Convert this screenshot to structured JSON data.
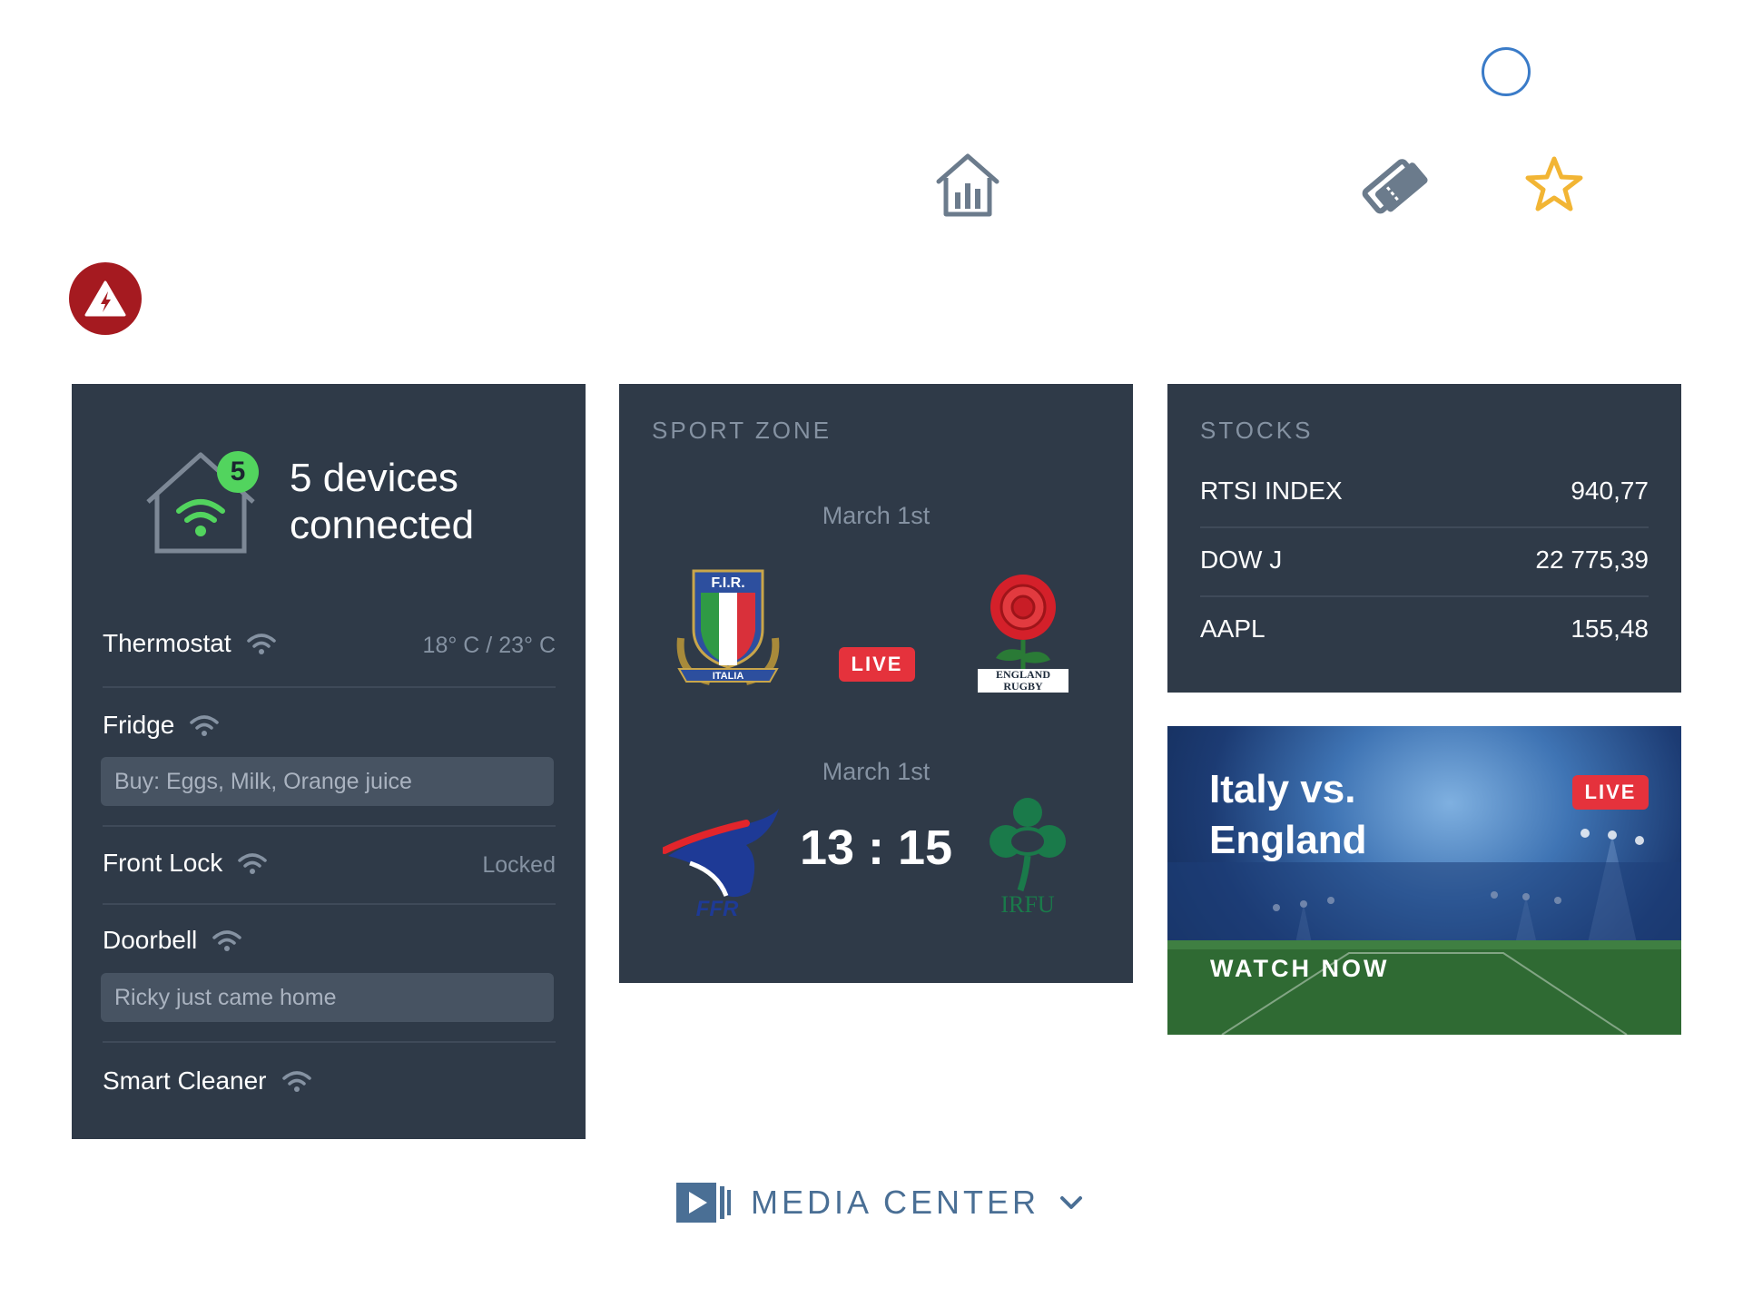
{
  "colors": {
    "card_bg": "#2f3a48",
    "accent_blue": "#3a7bc8",
    "alert_red": "#a51a20",
    "live_red": "#e5323c",
    "device_green": "#52d45e",
    "star_yellow": "#f2b534",
    "icon_gray": "#6b7b8c",
    "media_blue": "#4a6f95"
  },
  "top_icons": [
    "circle-icon",
    "home-stats-icon",
    "tickets-icon",
    "star-icon",
    "alert-icon"
  ],
  "smart_home": {
    "device_count": "5",
    "headline": "5 devices connected",
    "devices": [
      {
        "name": "Thermostat",
        "status": "18° C / 23° C",
        "note": ""
      },
      {
        "name": "Fridge",
        "status": "",
        "note": "Buy: Eggs, Milk, Orange juice"
      },
      {
        "name": "Front Lock",
        "status": "Locked",
        "note": ""
      },
      {
        "name": "Doorbell",
        "status": "",
        "note": "Ricky just came home"
      },
      {
        "name": "Smart Cleaner",
        "status": "",
        "note": ""
      }
    ]
  },
  "sport_zone": {
    "title": "SPORT ZONE",
    "matches": [
      {
        "date": "March 1st",
        "home_logo": "FIR Italia crest",
        "away_logo": "England Rugby rose",
        "home_logo_text": "F.I.R.",
        "home_ribbon": "ITALIA",
        "away_logo_text": "ENGLAND RUGBY",
        "status": "LIVE",
        "score": ""
      },
      {
        "date": "March 1st",
        "home_logo": "FFR rooster",
        "away_logo": "IRFU shamrock",
        "home_logo_text": "FFR",
        "away_logo_text": "IRFU",
        "status": "",
        "score": "13 : 15"
      }
    ]
  },
  "stocks": {
    "title": "STOCKS",
    "rows": [
      {
        "name": "RTSI INDEX",
        "value": "940,77"
      },
      {
        "name": "DOW J",
        "value": "22 775,39"
      },
      {
        "name": "AAPL",
        "value": "155,48"
      }
    ]
  },
  "live_match": {
    "title_line1": "Italy vs.",
    "title_line2": "England",
    "badge": "LIVE",
    "cta": "WATCH NOW"
  },
  "media_center": {
    "label": "MEDIA CENTER",
    "icon": "video-play-icon"
  }
}
